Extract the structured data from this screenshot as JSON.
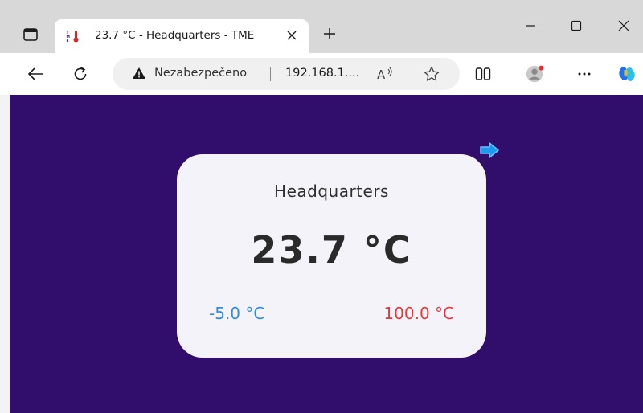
{
  "tab": {
    "title": "23.7 °C - Headquarters - TME"
  },
  "address_bar": {
    "security_label": "Nezabezpečeno",
    "url": "192.168.1...."
  },
  "page": {
    "location": "Headquarters",
    "temperature": "23.7 °C",
    "min_temperature": "-5.0 °C",
    "max_temperature": "100.0 °C"
  },
  "icons": {
    "tab_actions": "tab-actions-icon",
    "favicon": "thermometer-favicon-icon",
    "tab_close": "close-icon",
    "new_tab": "plus-icon",
    "minimize": "minimize-icon",
    "maximize": "maximize-icon",
    "close_window": "close-icon",
    "back": "back-arrow-icon",
    "refresh": "refresh-icon",
    "warning": "warning-triangle-icon",
    "read_aloud": "read-aloud-icon",
    "favorite": "star-icon",
    "split_screen": "split-screen-icon",
    "profile": "profile-avatar-icon",
    "more": "more-dots-icon",
    "copilot": "copilot-icon",
    "next": "right-arrow-icon"
  },
  "colors": {
    "page_background": "#320e6c",
    "card_background": "#f4f3f9",
    "min_color": "#2e8de0",
    "max_color": "#e23a3a",
    "arrow_color": "#3d9be9"
  }
}
